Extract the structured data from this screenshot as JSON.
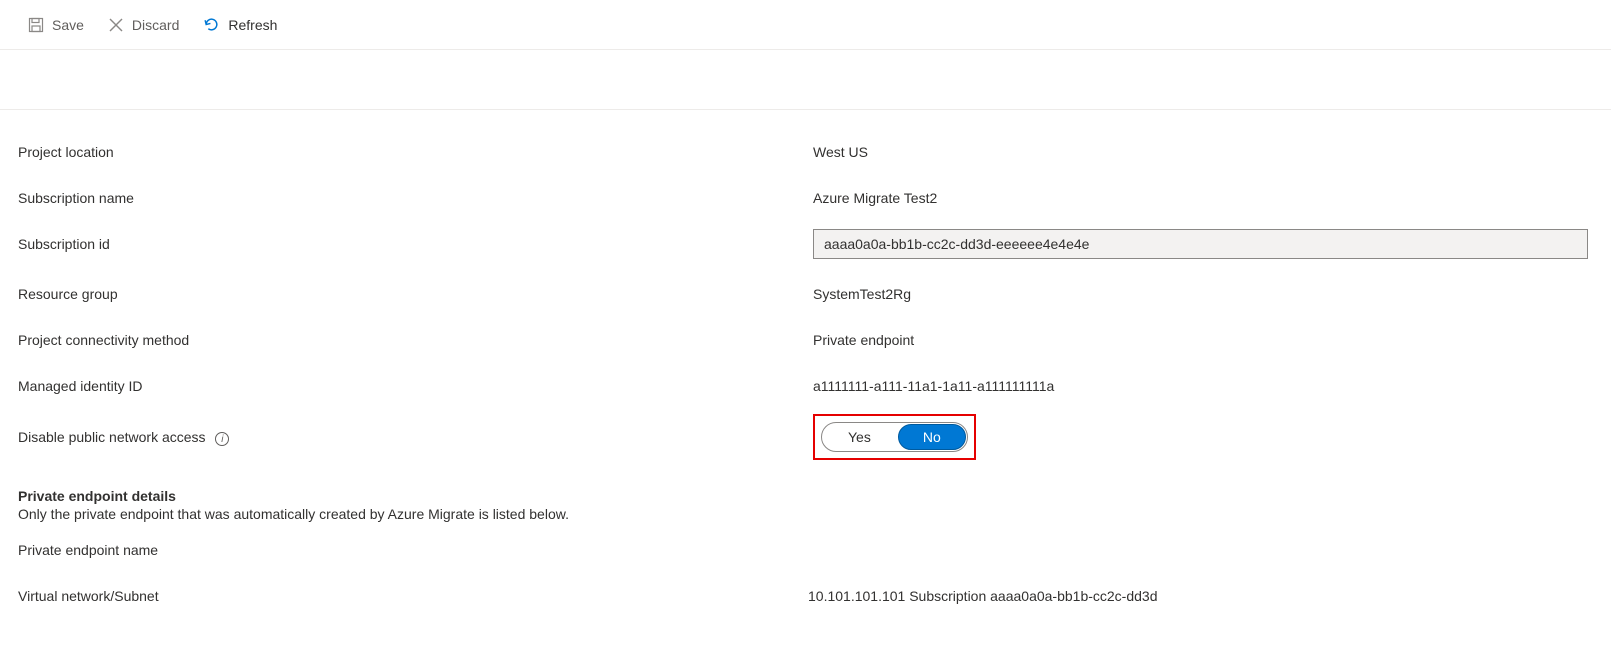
{
  "toolbar": {
    "save_label": "Save",
    "discard_label": "Discard",
    "refresh_label": "Refresh"
  },
  "labels": {
    "project_location": "Project location",
    "subscription_name": "Subscription name",
    "subscription_id": "Subscription id",
    "resource_group": "Resource group",
    "connectivity_method": "Project connectivity method",
    "managed_identity_id": "Managed identity ID",
    "disable_public_access": "Disable public network access",
    "private_endpoint_heading": "Private endpoint details",
    "private_endpoint_sub": "Only the private endpoint that was automatically created by Azure Migrate is listed below.",
    "private_endpoint_name": "Private endpoint name",
    "vnet_subnet": "Virtual network/Subnet"
  },
  "values": {
    "project_location": "West US",
    "subscription_name": "Azure Migrate Test2",
    "subscription_id": "aaaa0a0a-bb1b-cc2c-dd3d-eeeeee4e4e4e",
    "resource_group": "SystemTest2Rg",
    "connectivity_method": "Private endpoint",
    "managed_identity_id": "a1111111-a111-11a1-1a11-a111111111a",
    "vnet_subnet": "10.101.101.101 Subscription aaaa0a0a-bb1b-cc2c-dd3d"
  },
  "toggle": {
    "option_yes": "Yes",
    "option_no": "No"
  }
}
